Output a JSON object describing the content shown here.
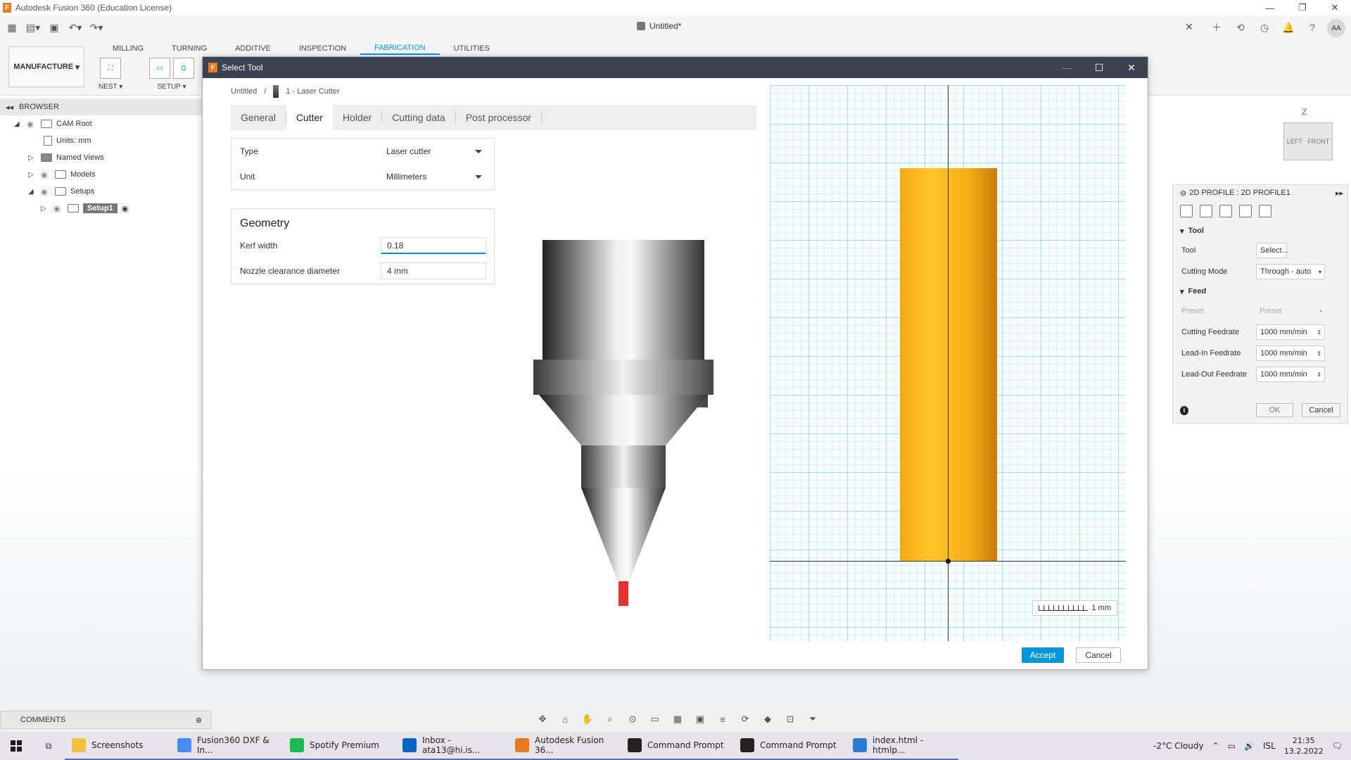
{
  "window": {
    "title": "Autodesk Fusion 360 (Education License)",
    "doc_tab": "Untitled*"
  },
  "ribbon": {
    "tabs": [
      "MILLING",
      "TURNING",
      "ADDITIVE",
      "INSPECTION",
      "FABRICATION",
      "UTILITIES"
    ],
    "active_tab": "FABRICATION",
    "workspace": "MANUFACTURE",
    "groups": [
      {
        "label": "NEST ▾"
      },
      {
        "label": "SETUP ▾"
      }
    ]
  },
  "browser": {
    "title": "BROWSER",
    "items": [
      {
        "label": "CAM Root"
      },
      {
        "label": "Units: mm"
      },
      {
        "label": "Named Views"
      },
      {
        "label": "Models"
      },
      {
        "label": "Setups"
      },
      {
        "label": "Setup1"
      }
    ]
  },
  "dialog": {
    "title": "Select Tool",
    "breadcrumb": {
      "root": "Untitled",
      "sep": "/",
      "tool": "1 - Laser Cutter"
    },
    "tabs": [
      "General",
      "Cutter",
      "Holder",
      "Cutting data",
      "Post processor"
    ],
    "active_tab": "Cutter",
    "type_label": "Type",
    "type_value": "Laser cutter",
    "unit_label": "Unit",
    "unit_value": "Millimeters",
    "geometry_title": "Geometry",
    "kerf_label": "Kerf width",
    "kerf_value": "0.18",
    "nozzle_label": "Nozzle clearance diameter",
    "nozzle_value": "4 mm",
    "scale_label": "1 mm",
    "accept": "Accept",
    "cancel": "Cancel",
    "accent": "#0696d7"
  },
  "viewcube": {
    "left": "LEFT",
    "front": "FRONT",
    "z": "Z"
  },
  "palette": {
    "title": "2D PROFILE : 2D PROFILE1",
    "tool_section": "Tool",
    "tool_label": "Tool",
    "tool_btn": "Select...",
    "mode_label": "Cutting Mode",
    "mode_value": "Through - auto",
    "feed_section": "Feed",
    "preset_label": "Preset",
    "preset_value": "Preset",
    "cut_feed_label": "Cutting Feedrate",
    "cut_feed_value": "1000 mm/min",
    "leadin_label": "Lead-In Feedrate",
    "leadin_value": "1000 mm/min",
    "leadout_label": "Lead-Out Feedrate",
    "leadout_value": "1000 mm/min",
    "ok": "OK",
    "cancel": "Cancel"
  },
  "comments": "COMMENTS",
  "taskbar": {
    "items": [
      {
        "label": "Screenshots",
        "color": "#f0c040"
      },
      {
        "label": "Fusion360 DXF & In...",
        "color": "#4a8af4"
      },
      {
        "label": "Spotify Premium",
        "color": "#1db954"
      },
      {
        "label": "Inbox - ata13@hi.is...",
        "color": "#0a64c8"
      },
      {
        "label": "Autodesk Fusion 36...",
        "color": "#e87a1d"
      },
      {
        "label": "Command Prompt",
        "color": "#222222"
      },
      {
        "label": "Command Prompt",
        "color": "#222222"
      },
      {
        "label": "index.html - htmlp...",
        "color": "#2b7bd6"
      }
    ],
    "weather": "-2°C  Cloudy",
    "lang": "ISL",
    "time": "21:35",
    "date": "13.2.2022"
  }
}
